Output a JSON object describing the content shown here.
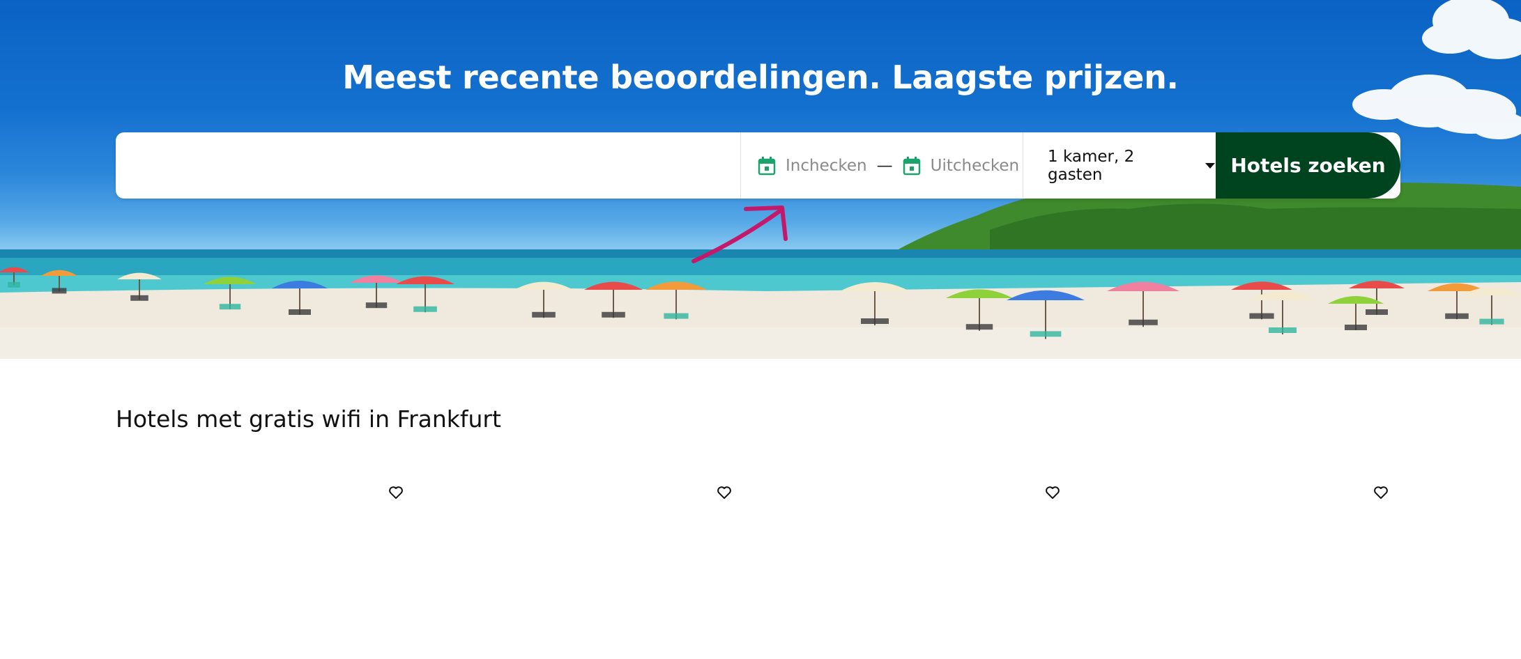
{
  "hero": {
    "title": "Meest recente beoordelingen. Laagste prijzen."
  },
  "search": {
    "destination_value": "",
    "destination_placeholder": "",
    "checkin_label": "Inchecken",
    "date_separator": "—",
    "checkout_label": "Uitchecken",
    "guests_label": "1 kamer, 2 gasten",
    "submit_label": "Hotels zoeken"
  },
  "section": {
    "title": "Hotels met gratis wifi in Frankfurt",
    "card_count_visible": 4
  },
  "icons": {
    "calendar": "calendar-icon",
    "caret": "chevron-down-icon",
    "favorite": "heart-outline-icon"
  },
  "colors": {
    "brand_dark_green": "#00441f",
    "calendar_green": "#1ba36e",
    "annotation_pink": "#c4186b"
  }
}
